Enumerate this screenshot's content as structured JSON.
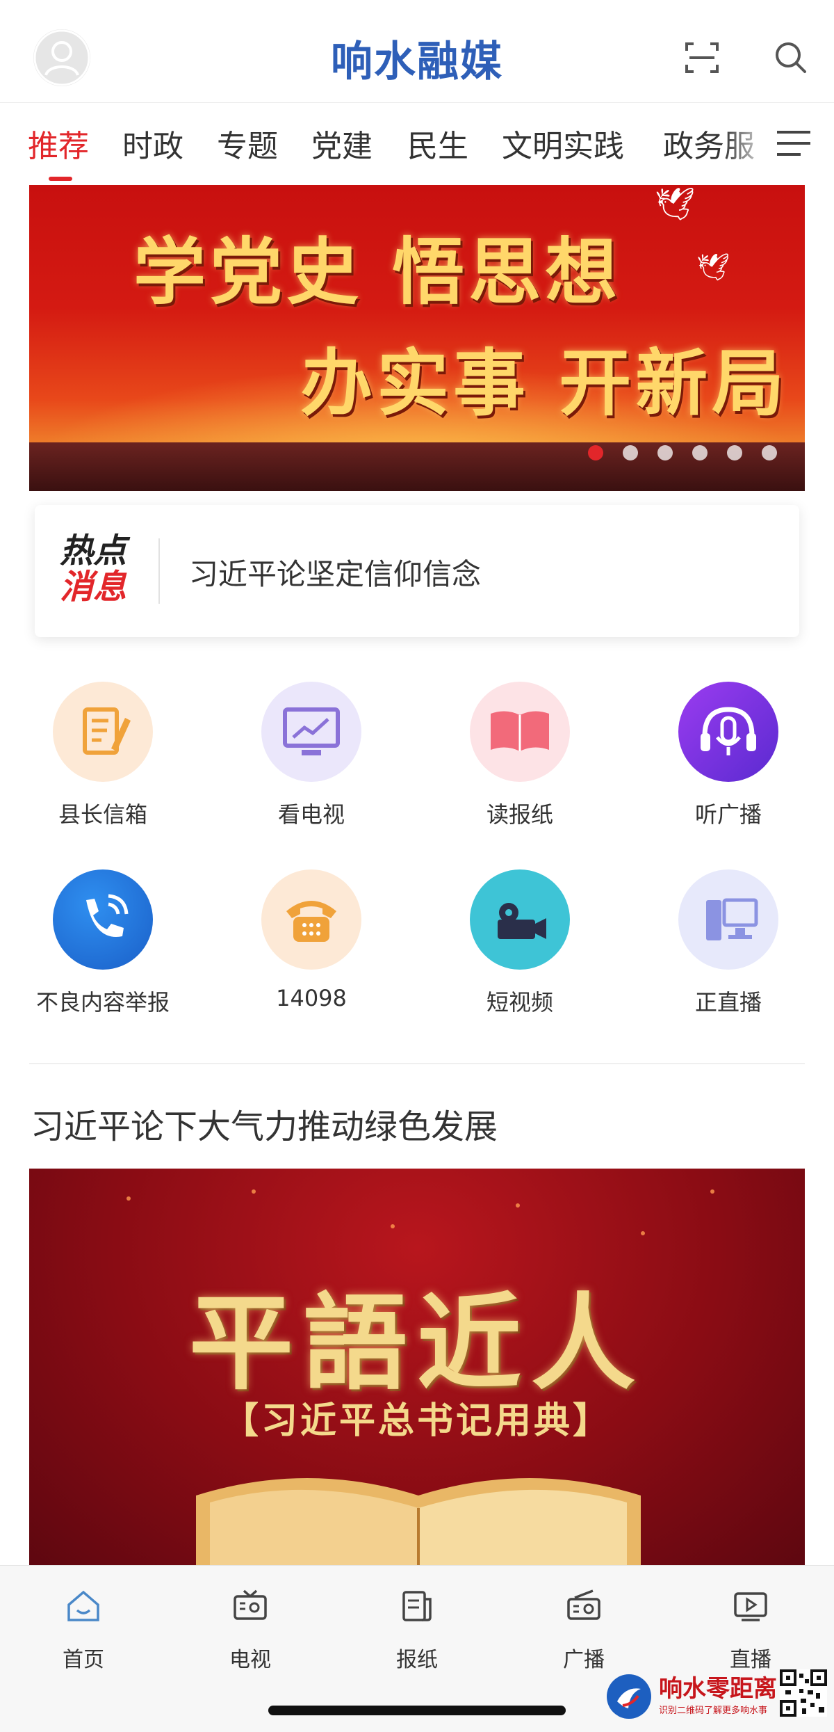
{
  "header": {
    "brand": "响水融媒",
    "icons": [
      "user-avatar-icon",
      "scan-icon",
      "search-icon"
    ]
  },
  "tabs": {
    "items": [
      "推荐",
      "时政",
      "专题",
      "党建",
      "民生",
      "文明实践",
      "政务服"
    ],
    "active_index": 0,
    "menu_icon": "menu-icon"
  },
  "banner": {
    "line1": "学党史 悟思想",
    "line2": "办实事 开新局",
    "slide_count": 6,
    "active_slide": 0
  },
  "hot_news": {
    "badge_line1": "热点",
    "badge_line2": "消息",
    "headline": "习近平论坚定信仰信念"
  },
  "services": [
    {
      "label": "县长信箱",
      "icon": "letter-edit-icon"
    },
    {
      "label": "看电视",
      "icon": "tv-chart-icon"
    },
    {
      "label": "读报纸",
      "icon": "open-book-icon"
    },
    {
      "label": "听广播",
      "icon": "headphone-mic-icon"
    },
    {
      "label": "不良内容举报",
      "icon": "phone-call-icon"
    },
    {
      "label": "14098",
      "icon": "telephone-icon"
    },
    {
      "label": "短视频",
      "icon": "video-camera-icon"
    },
    {
      "label": "正直播",
      "icon": "desktop-computer-icon"
    }
  ],
  "article": {
    "title": "习近平论下大气力推动绿色发展",
    "image_title": "平語近人",
    "image_subtitle": "【习近平总书记用典】"
  },
  "bottom_nav": [
    {
      "label": "首页",
      "icon": "home-icon"
    },
    {
      "label": "电视",
      "icon": "tv-icon"
    },
    {
      "label": "报纸",
      "icon": "newspaper-icon"
    },
    {
      "label": "广播",
      "icon": "radio-icon"
    },
    {
      "label": "直播",
      "icon": "live-play-icon"
    }
  ],
  "watermark": {
    "title": "响水零距离",
    "subtitle": "识别二维码了解更多响水事",
    "icons": [
      "watermark-logo-icon",
      "qr-code-icon"
    ]
  },
  "colors": {
    "brand_blue": "#2e5fb8",
    "accent_red": "#e2262a"
  }
}
